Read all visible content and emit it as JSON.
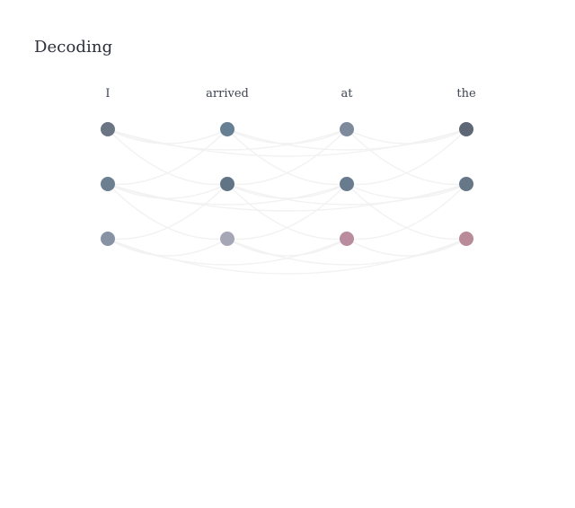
{
  "title": "Decoding",
  "tokens": [
    "I",
    "arrived",
    "at",
    "the"
  ],
  "layers": [
    {
      "nodes": [
        {
          "color": "#6b7583"
        },
        {
          "color": "#667f92"
        },
        {
          "color": "#7d8a9b"
        },
        {
          "color": "#5e6775"
        }
      ]
    },
    {
      "nodes": [
        {
          "color": "#6c7f91"
        },
        {
          "color": "#617486"
        },
        {
          "color": "#697c8f"
        },
        {
          "color": "#667788"
        }
      ]
    },
    {
      "nodes": [
        {
          "color": "#8793a5"
        },
        {
          "color": "#a5a6b6"
        },
        {
          "color": "#b98c9e"
        },
        {
          "color": "#b98a98"
        }
      ]
    }
  ],
  "link_color": "#f2f2f2"
}
